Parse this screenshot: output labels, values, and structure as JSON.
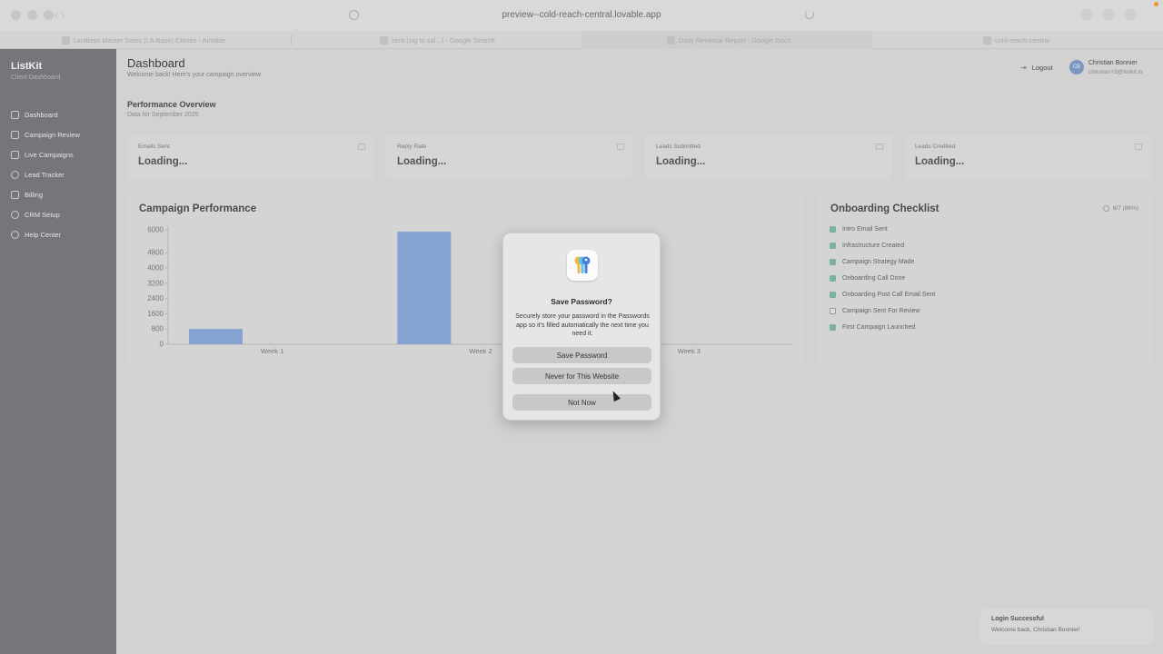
{
  "browser": {
    "url": "preview--cold-reach-central.lovable.app",
    "tabs": [
      {
        "title": "Limitless Master Sales (LA Base) Clones - Airtable",
        "active": false
      },
      {
        "title": "sent (sig to sal...) - Google Search",
        "active": false
      },
      {
        "title": "Daily Revenue Report - Google Docs",
        "active": true
      },
      {
        "title": "cold-reach-central",
        "active": false
      }
    ]
  },
  "sidebar": {
    "brand": "ListKit",
    "subtitle": "Client Dashboard",
    "items": [
      {
        "label": "Dashboard",
        "icon": "grid-icon"
      },
      {
        "label": "Campaign Review",
        "icon": "document-icon"
      },
      {
        "label": "Live Campaigns",
        "icon": "mail-icon"
      },
      {
        "label": "Lead Tracker",
        "icon": "users-icon"
      },
      {
        "label": "Billing",
        "icon": "card-icon"
      },
      {
        "label": "CRM Setup",
        "icon": "settings-icon"
      },
      {
        "label": "Help Center",
        "icon": "help-icon"
      }
    ]
  },
  "header": {
    "title": "Dashboard",
    "subtitle": "Welcome back! Here's your campaign overview",
    "logout_label": "Logout",
    "user_initials": "CB",
    "user_name": "Christian Bonnier",
    "user_email": "christian+3@listkit.io"
  },
  "overview": {
    "title": "Performance Overview",
    "subtitle": "Data for September 2025",
    "stats": [
      {
        "label": "Emails Sent",
        "value": "Loading..."
      },
      {
        "label": "Reply Rate",
        "value": "Loading..."
      },
      {
        "label": "Leads Submitted",
        "value": "Loading..."
      },
      {
        "label": "Leads Credited",
        "value": "Loading..."
      }
    ]
  },
  "campaign_panel": {
    "title": "Campaign Performance"
  },
  "chart_data": {
    "type": "bar",
    "categories": [
      "Week 1",
      "Week 2",
      "Week 3"
    ],
    "values": [
      800,
      5900,
      0
    ],
    "ylim": [
      0,
      6000
    ],
    "yticks": [
      0,
      800,
      1600,
      2400,
      3200,
      4000,
      4800,
      6000
    ],
    "bar_color": "#85a2d1",
    "grid": false
  },
  "checklist": {
    "title": "Onboarding Checklist",
    "progress": "6/7 (86%)",
    "items": [
      {
        "label": "Intro Email Sent",
        "done": true
      },
      {
        "label": "Infrastructure Created",
        "done": true
      },
      {
        "label": "Campaign Strategy Made",
        "done": true
      },
      {
        "label": "Onboarding Call Done",
        "done": true
      },
      {
        "label": "Onboarding Post Call Email Sent",
        "done": true
      },
      {
        "label": "Campaign Sent For Review",
        "done": false
      },
      {
        "label": "First Campaign Launched",
        "done": true
      }
    ]
  },
  "modal": {
    "title": "Save Password?",
    "body": "Securely store your password in the Passwords app so it's filled automatically the next time you need it.",
    "buttons": [
      "Save Password",
      "Never for This Website",
      "Not Now"
    ]
  },
  "toast": {
    "title": "Login Successful",
    "message": "Welcome back, Christian Bonnier!"
  }
}
